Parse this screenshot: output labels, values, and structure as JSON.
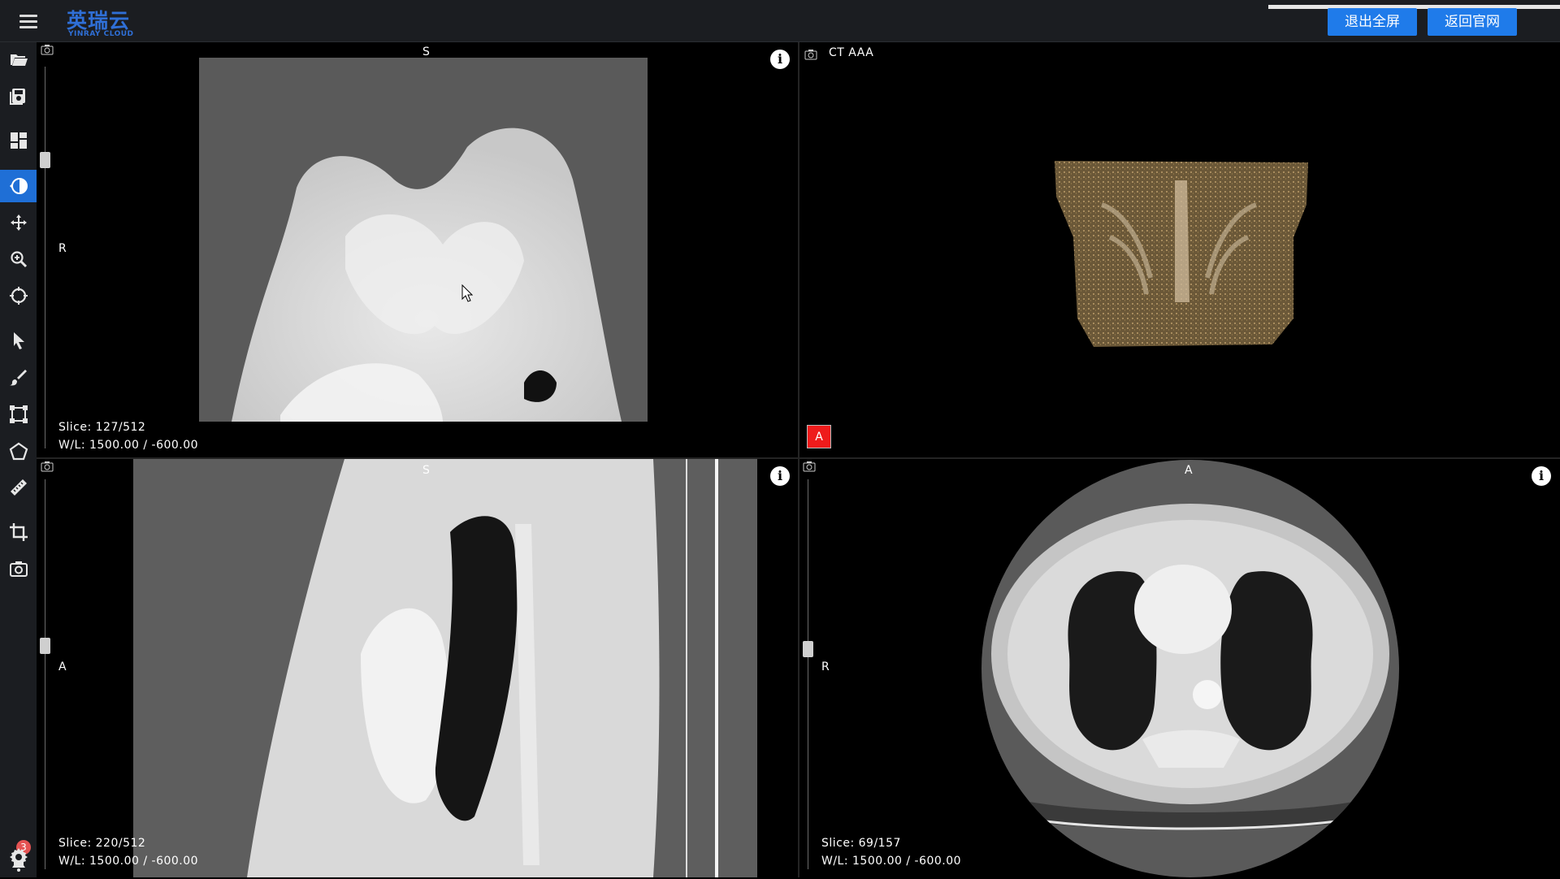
{
  "header": {
    "logo_cn": "英瑞云",
    "logo_en": "YINRAY CLOUD",
    "exit_fullscreen_label": "退出全屏",
    "back_to_site_label": "返回官网"
  },
  "sidebar": {
    "tools": [
      {
        "icon": "folder-open-icon"
      },
      {
        "icon": "save-icon"
      },
      {
        "icon": "layout-icon"
      },
      {
        "icon": "window-level-icon",
        "active": true
      },
      {
        "icon": "pan-icon"
      },
      {
        "icon": "zoom-icon"
      },
      {
        "icon": "rotate-icon"
      },
      {
        "icon": "pointer-icon"
      },
      {
        "icon": "brush-icon"
      },
      {
        "icon": "bounding-box-icon"
      },
      {
        "icon": "polygon-icon"
      },
      {
        "icon": "ruler-icon"
      },
      {
        "icon": "crop-icon"
      },
      {
        "icon": "screenshot-icon"
      },
      {
        "icon": "notification-icon"
      },
      {
        "icon": "settings-icon"
      }
    ],
    "notification_count": "3"
  },
  "viewports": {
    "coronal": {
      "top_label": "S",
      "left_label": "R",
      "slice": "Slice: 127/512",
      "wl": "W/L: 1500.00 / -600.00"
    },
    "volume": {
      "title": "CT AAA",
      "orientation_tag": "A"
    },
    "sagittal": {
      "top_label": "S",
      "left_label": "A",
      "slice": "Slice: 220/512",
      "wl": "W/L: 1500.00 / -600.00"
    },
    "axial": {
      "top_label": "A",
      "left_label": "R",
      "slice": "Slice: 69/157",
      "wl": "W/L: 1500.00 / -600.00"
    }
  },
  "colors": {
    "accent": "#1f7bea",
    "tag_red": "#ee1b1b",
    "badge_red": "#e55353",
    "logo_blue": "#2f6fd6"
  }
}
